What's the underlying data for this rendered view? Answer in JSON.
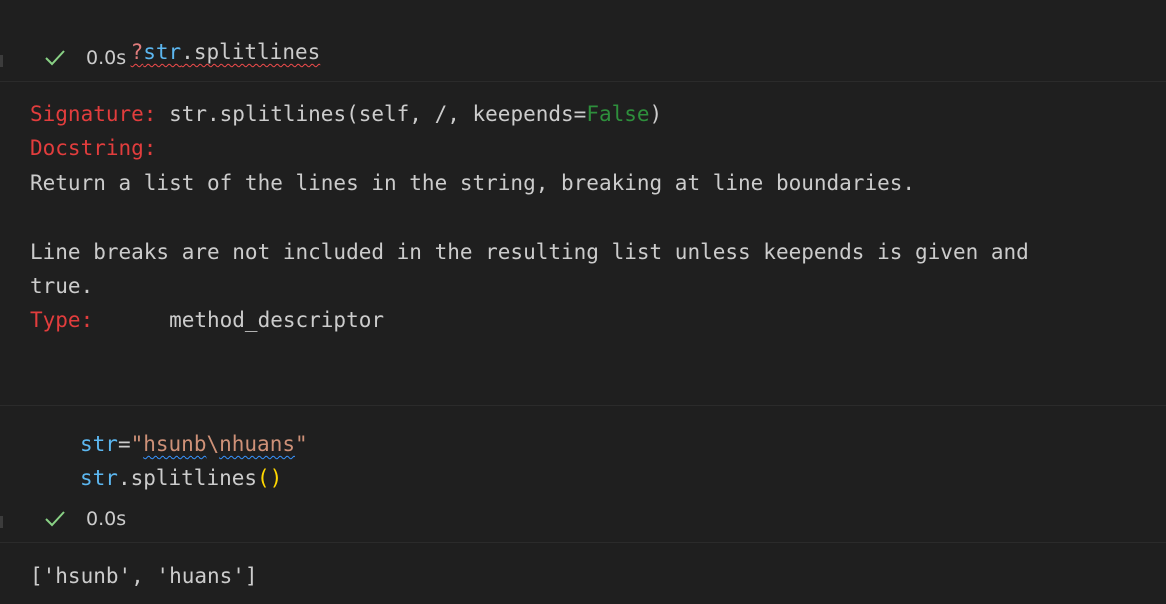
{
  "cell1": {
    "code": {
      "prefix": "?",
      "obj": "str",
      "rest": ".splitlines"
    },
    "exec_time": "0.0s"
  },
  "help_output": {
    "signature_label": "Signature:",
    "signature_pre": " str.splitlines(self, /, keepends=",
    "signature_false": "False",
    "signature_post": ")",
    "docstring_label": "Docstring:",
    "doc_line1": "Return a list of the lines in the string, breaking at line boundaries.",
    "doc_line2": "Line breaks are not included in the resulting list unless keepends is given and",
    "doc_line3": "true.",
    "type_label": "Type:",
    "type_value": "      method_descriptor"
  },
  "cell2": {
    "line1_var": "str",
    "line1_eq": "=",
    "line1_q1": "\"",
    "line1_str1": "hsunb",
    "line1_esc": "\\",
    "line1_str2": "nhuans",
    "line1_q2": "\"",
    "line2_var": "str",
    "line2_method": ".splitlines",
    "line2_parens": "()",
    "exec_time": "0.0s"
  },
  "cell2_output": "['hsunb', 'huans']",
  "colors": {
    "background": "#1f1f1f",
    "success_check": "#89d185",
    "keyword_red": "#e23d3d",
    "false_green": "#2e8f3c",
    "variable_blue": "#5cb7f0",
    "string_orange": "#ce9178"
  }
}
